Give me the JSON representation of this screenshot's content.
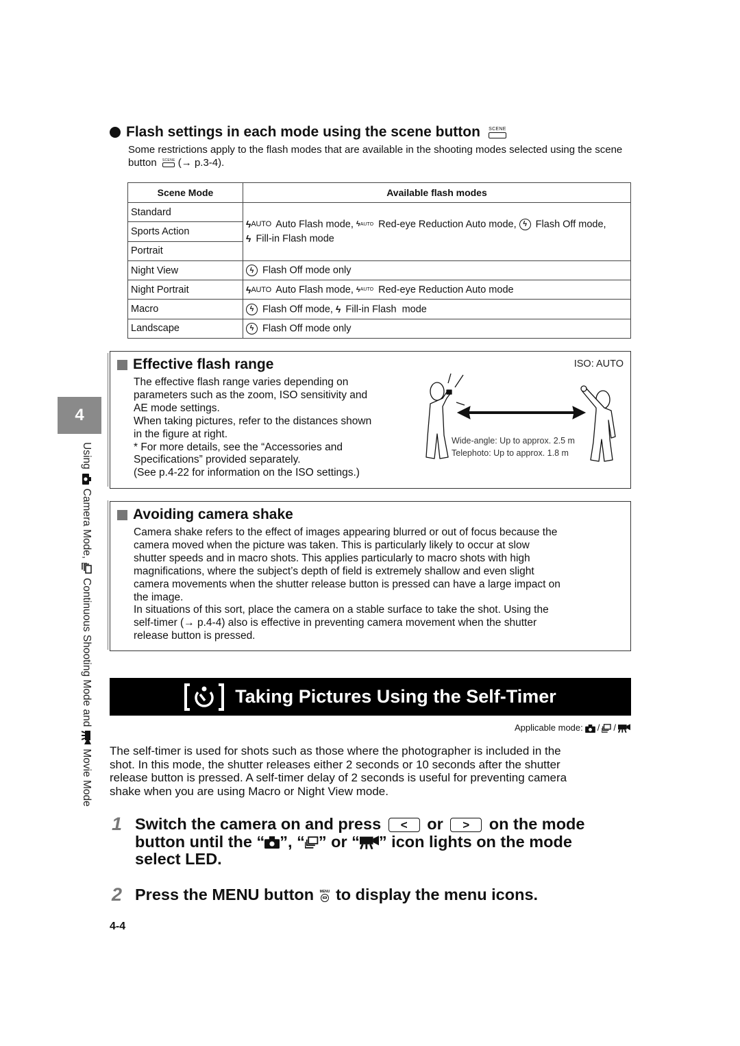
{
  "side": {
    "chapter_number": "4",
    "text_parts": [
      "Using",
      "Camera Mode,",
      "Continuous Shooting Mode and",
      "Movie Mode"
    ],
    "icons": [
      "camera-icon",
      "continuous-shooting-icon",
      "movie-icon"
    ]
  },
  "flash_section": {
    "heading": "Flash settings in each mode using the scene button",
    "scene_icon_label": "SCENE",
    "body_before": "Some restrictions apply to the flash modes that are available in the shooting modes selected using the scene button",
    "body_after": "(→ p.3-4).",
    "table": {
      "headers": [
        "Scene Mode",
        "Available flash modes"
      ],
      "auto_label": "AUTO",
      "rows": [
        {
          "mode": "Standard"
        },
        {
          "mode": "Sports Action"
        },
        {
          "mode": "Portrait"
        },
        {
          "mode": "Night View"
        },
        {
          "mode": "Night Portrait"
        },
        {
          "mode": "Macro"
        },
        {
          "mode": "Landscape"
        }
      ],
      "group_text": {
        "auto_flash": "Auto Flash mode,",
        "redeye_auto": "Red-eye Reduction Auto mode,",
        "flash_off": "Flash Off mode,",
        "fill_in": "Fill-in Flash mode"
      },
      "night_view": "Flash Off mode only",
      "night_portrait": {
        "auto_flash": "Auto Flash mode,",
        "redeye_auto": "Red-eye Reduction Auto mode"
      },
      "macro": {
        "flash_off": "Flash Off mode,",
        "fill_in": "Fill-in Flash  mode"
      },
      "landscape": "Flash Off mode only"
    }
  },
  "flash_range": {
    "heading": "Effective flash range",
    "lines": [
      "The effective flash range varies depending on",
      "parameters such as the zoom, ISO sensitivity and",
      "AE mode settings.",
      "When taking pictures, refer to the distances shown",
      "in the figure at right.",
      "* For more details, see the “Accessories and",
      "Specifications” provided separately.",
      "(See p.4-22 for information on the ISO settings.)"
    ],
    "figure": {
      "iso_label": "ISO: AUTO",
      "wide_label": "Wide-angle: Up to approx. 2.5 m",
      "tele_label": "Telephoto: Up to approx. 1.8 m"
    }
  },
  "camera_shake": {
    "heading": "Avoiding camera shake",
    "lines": [
      "Camera shake refers to the effect of images appearing blurred or out of focus because the",
      "camera moved when the picture was taken. This is particularly likely to occur at slow",
      "shutter speeds and in macro shots. This applies particularly to macro shots with high",
      "magnifications, where the subject’s depth of field is extremely shallow and even slight",
      "camera movements when the shutter release button is pressed can have a large impact on",
      "the image.",
      "In situations of this sort, place the camera on a stable surface to take the shot. Using the",
      "self-timer (→ p.4-4) also is effective in preventing camera movement when the shutter",
      "release button is pressed."
    ]
  },
  "self_timer": {
    "title": "Taking Pictures Using the Self-Timer",
    "applicable_label": "Applicable mode:",
    "intro_lines": [
      "The self-timer is used for shots such as those where the photographer is included in the",
      "shot. In this mode, the shutter releases either 2 seconds or 10 seconds after the shutter",
      "release button is pressed. A self-timer delay of 2 seconds is useful for preventing camera",
      "shake when you are using Macro or Night View mode."
    ],
    "steps": [
      {
        "number": "1",
        "part1": "Switch the camera on and press",
        "key_left": "<",
        "or": "or",
        "key_right": ">",
        "part2": "on the mode",
        "part3": "button until the “",
        "sep1": "”, “",
        "sep2": "” or “",
        "part4": "” icon lights on the mode",
        "part5": "select LED."
      },
      {
        "number": "2",
        "part1": "Press the MENU button",
        "menu_label": "MENU",
        "part2": "to display the menu icons."
      }
    ]
  },
  "page_number": "4-4"
}
